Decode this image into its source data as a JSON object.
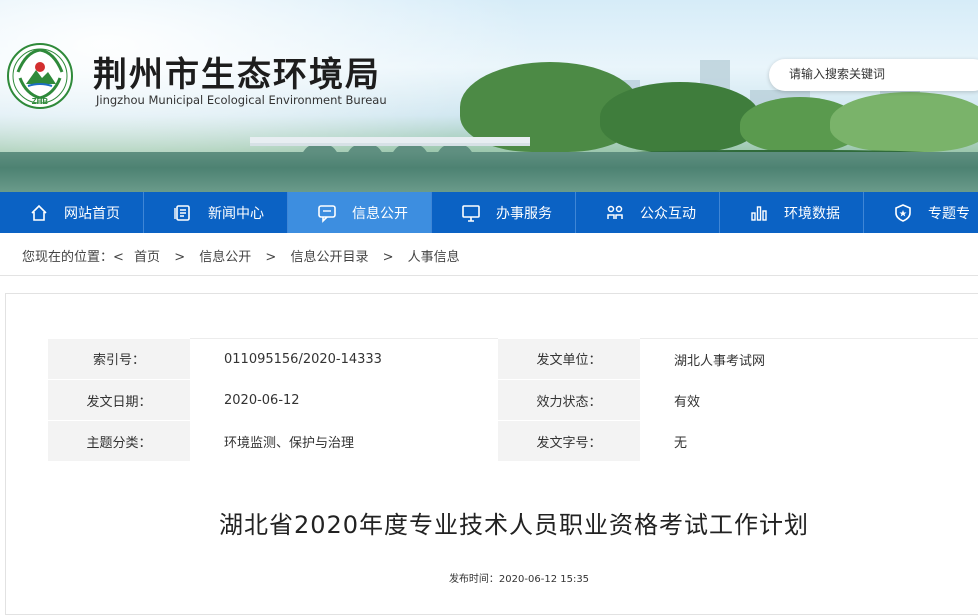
{
  "site": {
    "title_cn": "荆州市生态环境局",
    "title_en": "Jingzhou Municipal Ecological Environment Bureau",
    "logo_text": "ZHB",
    "search_placeholder": "请输入搜索关键词"
  },
  "nav": [
    {
      "label": "网站首页",
      "icon": "home-icon"
    },
    {
      "label": "新闻中心",
      "icon": "news-icon"
    },
    {
      "label": "信息公开",
      "icon": "chat-icon",
      "active": true
    },
    {
      "label": "办事服务",
      "icon": "monitor-icon"
    },
    {
      "label": "公众互动",
      "icon": "people-icon"
    },
    {
      "label": "环境数据",
      "icon": "bar-chart-icon"
    },
    {
      "label": "专题专",
      "icon": "shield-icon"
    }
  ],
  "breadcrumb": {
    "prefix": "您现在的位置：<",
    "items": [
      "首页",
      "信息公开",
      "信息公开目录",
      "人事信息"
    ]
  },
  "meta": [
    [
      {
        "k": "索引号：",
        "v": "011095156/2020-14333"
      },
      {
        "k": "发文单位：",
        "v": "湖北人事考试网"
      }
    ],
    [
      {
        "k": "发文日期：",
        "v": "2020-06-12"
      },
      {
        "k": "效力状态：",
        "v": "有效"
      }
    ],
    [
      {
        "k": "主题分类：",
        "v": "环境监测、保护与治理"
      },
      {
        "k": "发文字号：",
        "v": "无"
      }
    ]
  ],
  "article": {
    "title": "湖北省2020年度专业技术人员职业资格考试工作计划",
    "published": "发布时间：2020-06-12 15:35"
  },
  "colors": {
    "nav_bg": "#0b62c4",
    "nav_active": "#3d8ee0"
  }
}
